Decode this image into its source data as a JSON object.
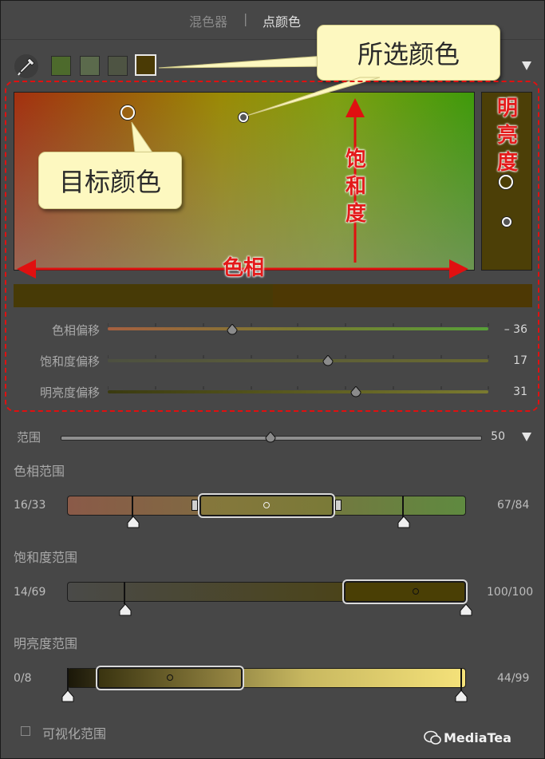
{
  "tabs": {
    "mixer": "混色器",
    "separator": "|",
    "point_color": "点颜色"
  },
  "swatches": [
    "#4d6a2c",
    "#5b6a4c",
    "#4e5443",
    "#4a3a05"
  ],
  "callouts": {
    "selected_color": "所选颜色",
    "target_color": "目标颜色"
  },
  "annotations": {
    "hue": "色相",
    "saturation": "饱和度",
    "luminance": "明亮度"
  },
  "sliders": [
    {
      "label": "色相偏移",
      "value": "– 36",
      "position": 0.31
    },
    {
      "label": "饱和度偏移",
      "value": "17",
      "position": 0.58
    },
    {
      "label": "明亮度偏移",
      "value": "31",
      "position": 0.65
    }
  ],
  "range": {
    "label": "范围",
    "value": "50",
    "position": 0.5
  },
  "hue_range": {
    "title": "色相范围",
    "left": "16/33",
    "right": "67/84"
  },
  "sat_range": {
    "title": "饱和度范围",
    "left": "14/69",
    "right": "100/100"
  },
  "lum_range": {
    "title": "明亮度范围",
    "left": "0/8",
    "right": "44/99"
  },
  "visualize": {
    "label": "可视化范围",
    "checked": false
  },
  "watermark": "MediaTea",
  "colors": {
    "annotation_red": "#e01010",
    "callout_bg": "#fdf8c0",
    "panel_bg": "#474747"
  }
}
